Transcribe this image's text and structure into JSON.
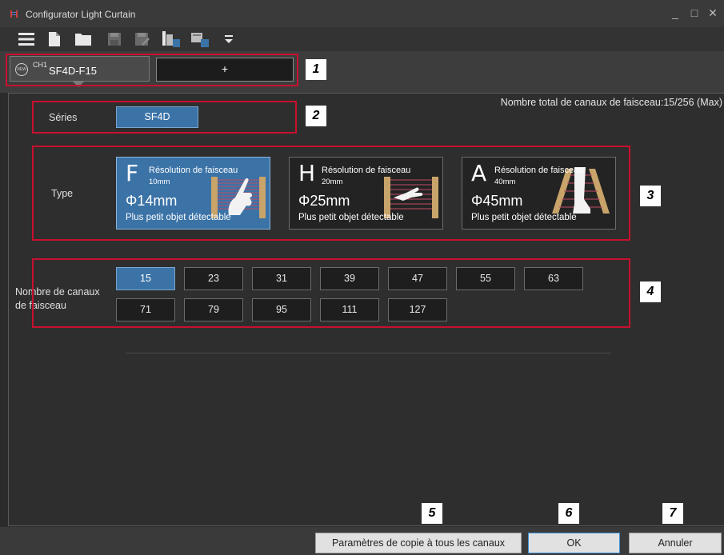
{
  "window": {
    "title": "Configurator Light Curtain",
    "minimize_glyph": "_",
    "maximize_glyph": "□",
    "close_glyph": "✕"
  },
  "toolbar": {
    "icons": [
      "menu-icon",
      "new-file-icon",
      "open-folder-icon",
      "save-icon",
      "save-as-icon",
      "read-device-icon",
      "write-device-icon",
      "dropdown-arrow-icon"
    ]
  },
  "channel": {
    "badge": "NEW",
    "tab_sup": "CH1",
    "tab_name": "SF4D-F15",
    "add_label": "+"
  },
  "total_channels_label": "Nombre total de canaux de faisceau:15/256 (Max)",
  "series": {
    "label": "Séries",
    "options": [
      "SF4D"
    ],
    "selected": "SF4D"
  },
  "type": {
    "label": "Type",
    "cards": [
      {
        "letter": "F",
        "resolution_label": "Résolution de faisceau",
        "resolution": "10mm",
        "diameter": "Φ14mm",
        "description": "Plus petit objet détectable",
        "selected": true
      },
      {
        "letter": "H",
        "resolution_label": "Résolution de faisceau",
        "resolution": "20mm",
        "diameter": "Φ25mm",
        "description": "Plus petit objet détectable",
        "selected": false
      },
      {
        "letter": "A",
        "resolution_label": "Résolution de faisceau",
        "resolution": "40mm",
        "diameter": "Φ45mm",
        "description": "Plus petit objet détectable",
        "selected": false
      }
    ]
  },
  "beam_channels": {
    "label_line1": "Nombre de canaux",
    "label_line2": "de faisceau",
    "options": [
      "15",
      "23",
      "31",
      "39",
      "47",
      "55",
      "63",
      "71",
      "79",
      "95",
      "111",
      "127"
    ],
    "selected": "15"
  },
  "footer": {
    "copy_label": "Paramètres de copie à tous les canaux",
    "ok_label": "OK",
    "cancel_label": "Annuler"
  },
  "annotations": [
    "1",
    "2",
    "3",
    "4",
    "5",
    "6",
    "7"
  ],
  "colors": {
    "accent": "#3b73a7",
    "annotation_red": "#c8102e",
    "background": "#2b2b2b"
  }
}
